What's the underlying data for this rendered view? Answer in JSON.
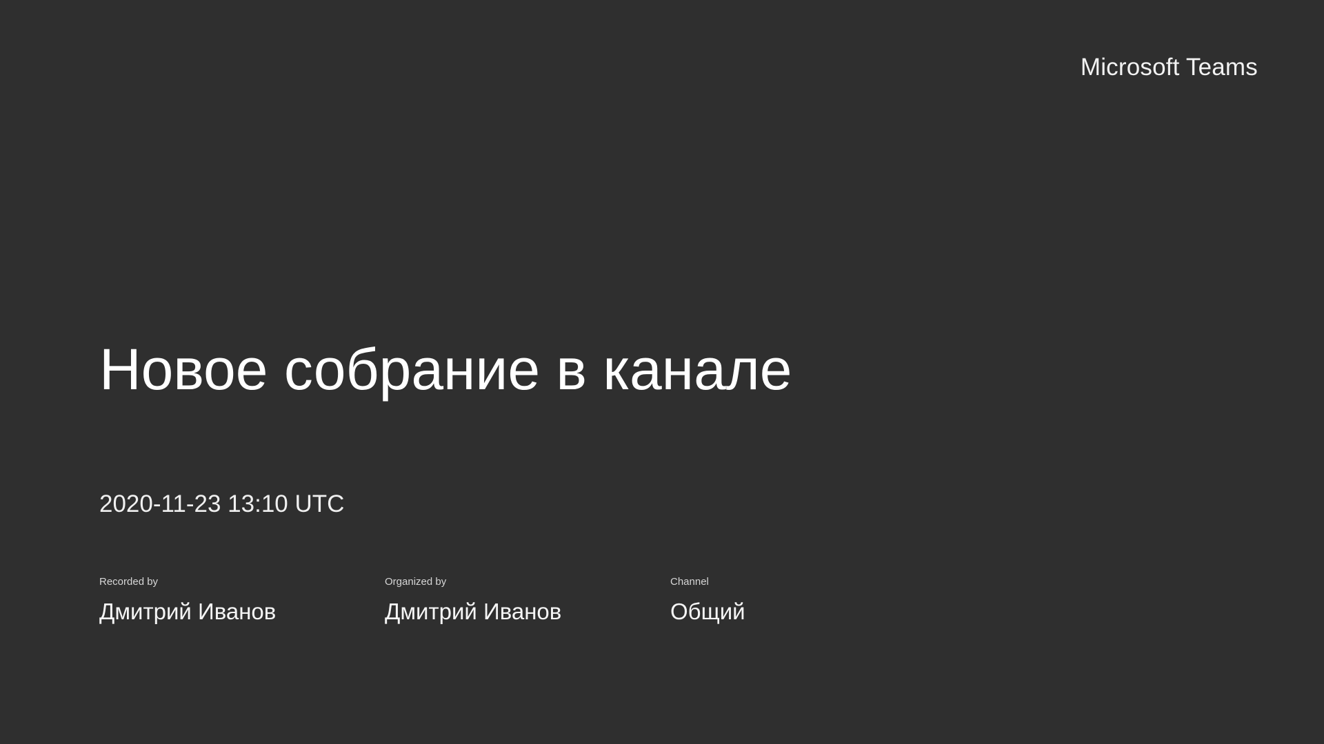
{
  "app": {
    "brand": "Microsoft Teams"
  },
  "meeting": {
    "title": "Новое собрание в канале",
    "datetime": "2020-11-23 13:10 UTC"
  },
  "details": [
    {
      "label": "Recorded by",
      "value": "Дмитрий Иванов"
    },
    {
      "label": "Organized by",
      "value": "Дмитрий Иванов"
    },
    {
      "label": "Channel",
      "value": "Общий"
    }
  ],
  "colors": {
    "background": "#2f2f2f",
    "text": "#ffffff"
  }
}
